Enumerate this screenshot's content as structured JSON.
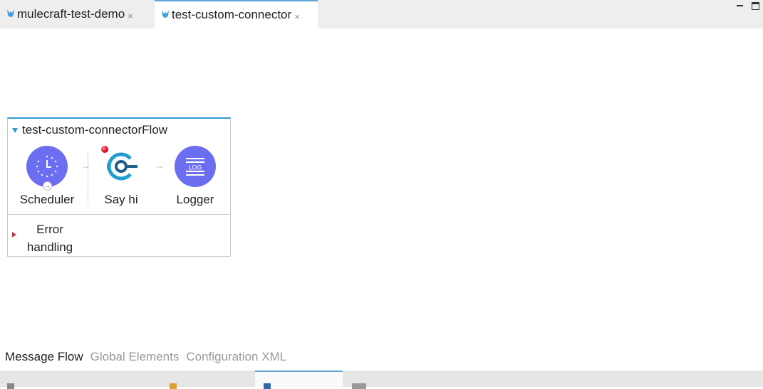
{
  "editor_tabs": [
    {
      "label": "mulecraft-test-demo",
      "active": false
    },
    {
      "label": "test-custom-connector",
      "active": true
    }
  ],
  "close_glyph": "×",
  "flow": {
    "title": "test-custom-connectorFlow",
    "nodes": [
      {
        "label": "Scheduler",
        "icon": "clock-icon"
      },
      {
        "label": "Say hi",
        "icon": "connector-icon",
        "breakpoint": true
      },
      {
        "label": "Logger",
        "icon": "log-icon"
      }
    ],
    "error_handling_line1": "Error",
    "error_handling_line2": "handling"
  },
  "view_tabs": {
    "message_flow": "Message Flow",
    "global_elements": "Global Elements",
    "configuration_xml": "Configuration XML"
  },
  "colors": {
    "accent_blue": "#2e9cd2",
    "processor_purple": "#6b6ef1",
    "connector_teal": "#1e9fd0",
    "breakpoint_red": "#e0001c"
  }
}
